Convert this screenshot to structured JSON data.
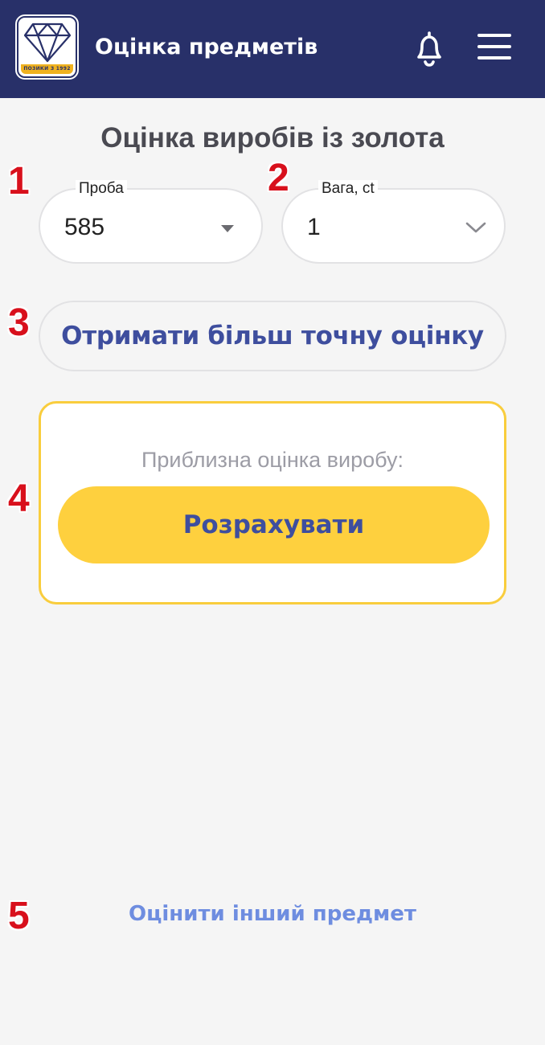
{
  "header": {
    "title": "Оцінка предметів",
    "logo_caption": "ПОЗИКИ З 1992",
    "background": "#283069"
  },
  "page": {
    "title": "Оцінка виробів із золота"
  },
  "form": {
    "purity": {
      "label": "Проба",
      "value": "585"
    },
    "weight": {
      "label": "Вага, ct",
      "value": "1"
    }
  },
  "actions": {
    "precise_estimate_label": "Отримати більш точну оцінку",
    "result_label": "Приблизна оцінка виробу:",
    "calculate_label": "Розрахувати",
    "other_item_label": "Оцінити інший предмет"
  },
  "markers": [
    "1",
    "2",
    "3",
    "4",
    "5"
  ],
  "colors": {
    "accent_yellow": "#fed03e",
    "button_text": "#3e4e9e",
    "link": "#6e8de0",
    "marker_red": "#d8101c"
  }
}
